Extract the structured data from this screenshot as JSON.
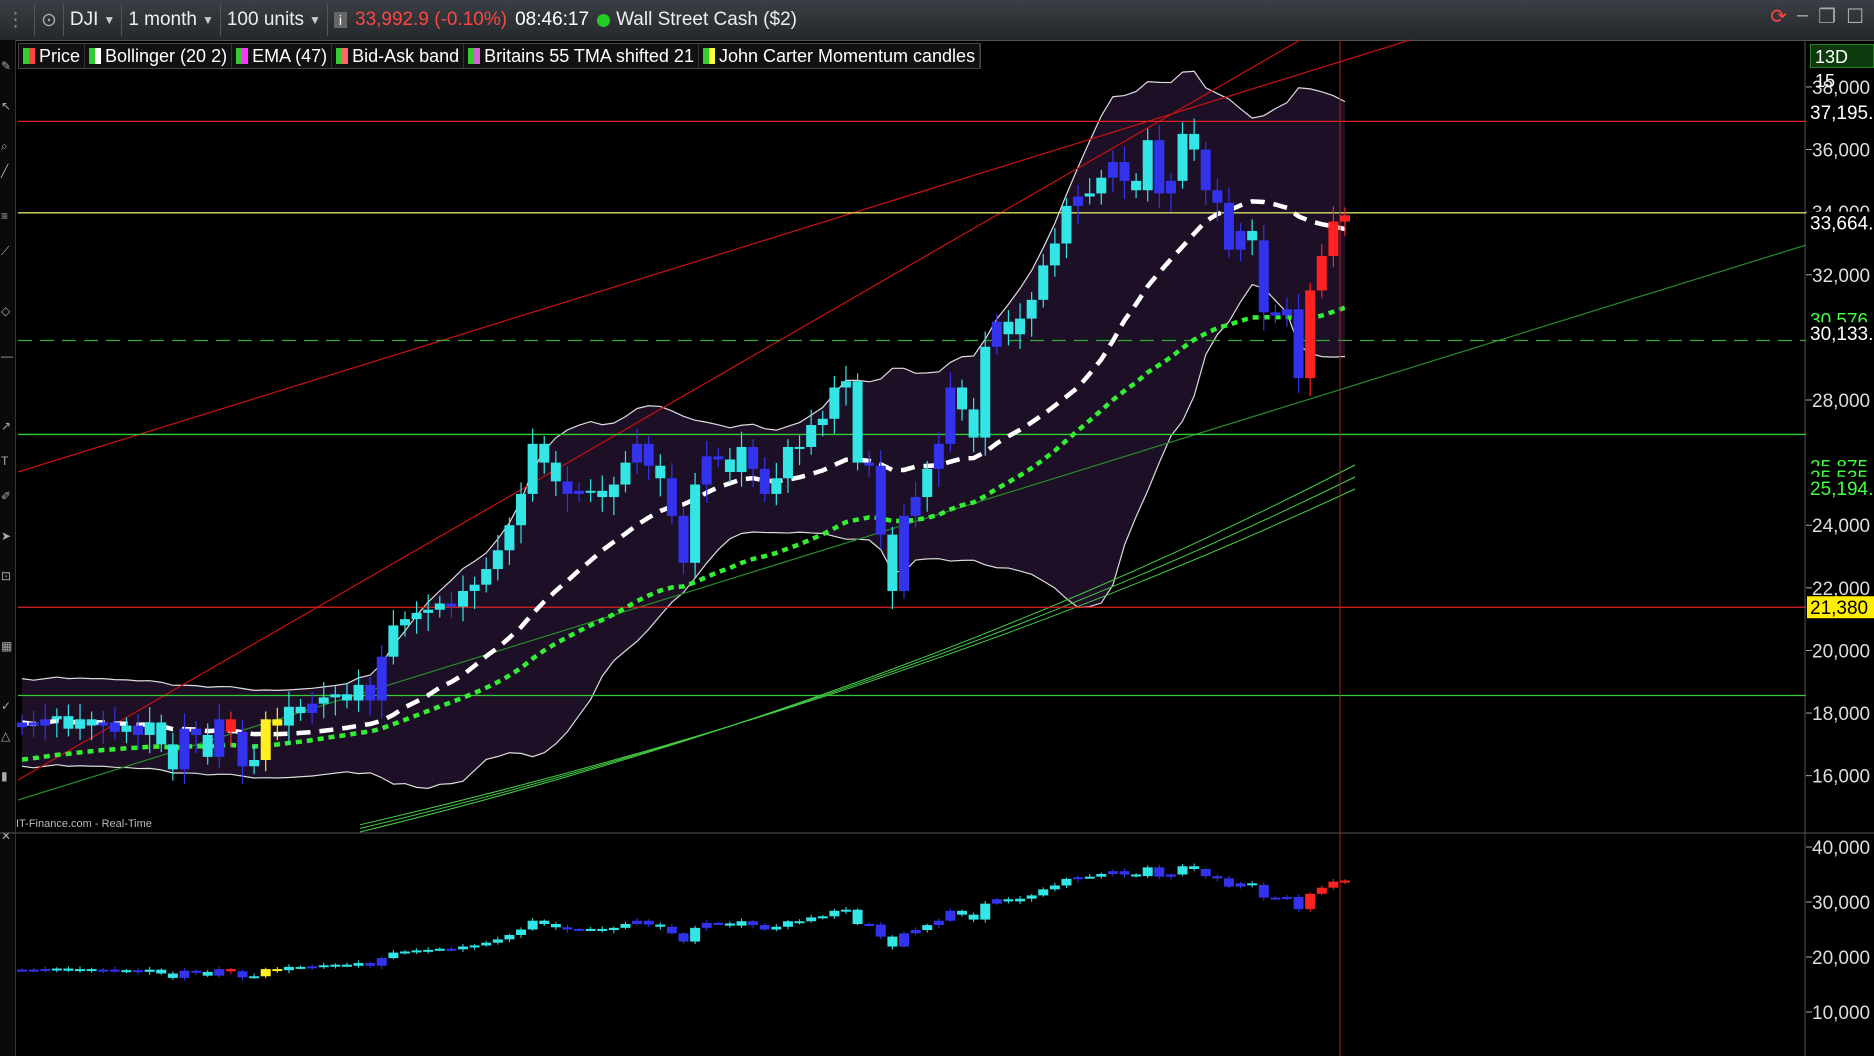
{
  "toolbar": {
    "instrument": "DJI",
    "timeframe": "1 month",
    "units": "100 units",
    "price": "33,992.9 (-0.10%)",
    "time": "08:46:17",
    "market": "Wall Street Cash ($2)"
  },
  "legend": [
    {
      "label": "Price",
      "color": "#ff4444"
    },
    {
      "label": "Bollinger (20 2)",
      "color": "#ffffff"
    },
    {
      "label": "EMA (47)",
      "color": "#ff33ff"
    },
    {
      "label": "Bid-Ask band",
      "color": "#ff6666"
    },
    {
      "label": "Britains 55 TMA shifted 21",
      "color": "#cc66cc"
    },
    {
      "label": "John Carter Momentum candles",
      "color": "#ffff33"
    }
  ],
  "period_badge": "13D 15",
  "source_text": "IT-Finance.com - Real-Time",
  "colors": {
    "up": "#33e5e5",
    "down": "#3333ee",
    "red": "#ff2222",
    "yellow": "#ffee22",
    "ema": "#33ee33",
    "mid": "#ffffff"
  },
  "chart_data": {
    "type": "candlestick",
    "main_axis": {
      "ylim": [
        14200,
        39500
      ],
      "ticks": [
        "38,000",
        "36,000",
        "34,000",
        "32,000",
        "28,000",
        "24,000",
        "22,000",
        "20,000",
        "18,000",
        "16,000"
      ],
      "tick_values": [
        38000,
        36000,
        34000,
        32000,
        28000,
        24000,
        22000,
        20000,
        18000,
        16000
      ],
      "price_tags": [
        {
          "label": "37,195.",
          "value": 37195,
          "bg": "#000000",
          "fg": "#ffffff"
        },
        {
          "label": "33,664.",
          "value": 33664,
          "bg": "#000000",
          "fg": "#ffffff"
        },
        {
          "label": "30,576.",
          "value": 30576,
          "bg": "#000000",
          "fg": "#44ff44"
        },
        {
          "label": "30,133.",
          "value": 30133,
          "bg": "#000000",
          "fg": "#ffffff"
        },
        {
          "label": "25,875",
          "value": 25875,
          "bg": "#000000",
          "fg": "#44ff44"
        },
        {
          "label": "25,535",
          "value": 25535,
          "bg": "#000000",
          "fg": "#44ff44"
        },
        {
          "label": "25,194.",
          "value": 25194,
          "bg": "#000000",
          "fg": "#44ff44"
        },
        {
          "label": "21,380",
          "value": 21380,
          "bg": "#ffee00",
          "fg": "#000000"
        }
      ]
    },
    "lower_axis": {
      "ylim": [
        2000,
        42000
      ],
      "ticks": [
        "40,000",
        "30,000",
        "20,000",
        "10,000"
      ],
      "tick_values": [
        40000,
        30000,
        20000,
        10000
      ]
    },
    "horizontal_lines": [
      {
        "value": 36900,
        "color": "#dd2222"
      },
      {
        "value": 33980,
        "color": "#dddd66"
      },
      {
        "value": 29900,
        "color": "#33aa33",
        "dash": true
      },
      {
        "value": 26900,
        "color": "#33cc33"
      },
      {
        "value": 21380,
        "color": "#dd2222"
      },
      {
        "value": 18560,
        "color": "#33cc33"
      }
    ],
    "closes": [
      17700,
      17600,
      17800,
      17900,
      17500,
      17800,
      17600,
      17700,
      17400,
      17600,
      17300,
      17700,
      17000,
      16200,
      17500,
      17300,
      16600,
      17800,
      17400,
      16300,
      16500,
      17800,
      17600,
      18200,
      18000,
      18300,
      18500,
      18600,
      18400,
      18900,
      18400,
      19800,
      20800,
      21000,
      21200,
      21300,
      21500,
      21400,
      21900,
      22100,
      22600,
      23200,
      24000,
      25000,
      26600,
      26000,
      25400,
      25000,
      25100,
      25100,
      24900,
      25300,
      26000,
      26600,
      25900,
      25500,
      24300,
      22800,
      25300,
      26200,
      26100,
      25700,
      26500,
      25800,
      25000,
      25500,
      26500,
      26500,
      27200,
      27400,
      28400,
      28600,
      26000,
      25900,
      23700,
      21900,
      24300,
      24900,
      25800,
      26600,
      28400,
      27700,
      26800,
      29700,
      30500,
      30100,
      30600,
      31200,
      32300,
      33000,
      34200,
      34500,
      34600,
      35100,
      35600,
      35000,
      34700,
      36300,
      34600,
      35000,
      36500,
      36000,
      34700,
      34300,
      32800,
      33400,
      33100,
      30800,
      30700,
      30900,
      28700,
      31500,
      32600,
      33700,
      33900
    ],
    "colors": "ddduuuudduduuuddudrduyyuuduuuudduuuuuduuuuuuuuudduuuudduddudduudduuuuuuuudduddudduuuduuuuuuduudduudduudddduddddrrrrry"
  }
}
